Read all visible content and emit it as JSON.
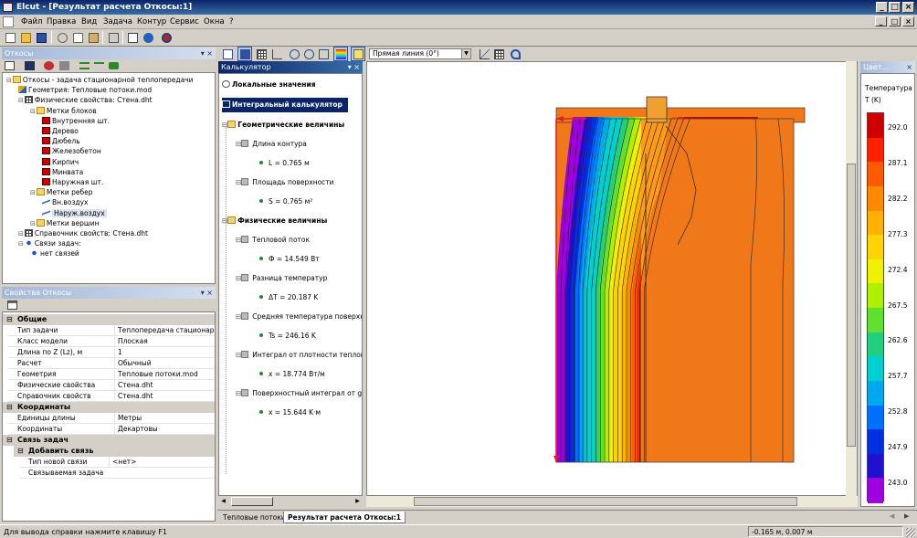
{
  "app": {
    "title": "Elcut - [Результат расчета Откосы:1]",
    "win_min": "_",
    "win_max": "□",
    "win_close": "×",
    "child_min": "_",
    "child_max": "□",
    "child_close": "×"
  },
  "menu": [
    "Файл",
    "Правка",
    "Вид",
    "Задача",
    "Контур",
    "Сервис",
    "Окна",
    "?"
  ],
  "problem_panel": {
    "title": "Откосы",
    "tree": [
      {
        "label": "Откосы - задача стационарной теплопередачи",
        "level": 0,
        "icon": "folder-icon"
      },
      {
        "label": "Геометрия: Тепловые потоки.mod",
        "level": 1,
        "icon": "geometry-icon"
      },
      {
        "label": "Физические свойства: Стена.dht",
        "level": 1,
        "icon": "table-icon"
      },
      {
        "label": "Метки блоков",
        "level": 2,
        "icon": "folder-icon"
      },
      {
        "label": "Внутренняя шт.",
        "level": 3,
        "icon": "block-label-icon"
      },
      {
        "label": "Дерево",
        "level": 3,
        "icon": "block-label-icon"
      },
      {
        "label": "Дюбель",
        "level": 3,
        "icon": "block-label-icon"
      },
      {
        "label": "Железобетон",
        "level": 3,
        "icon": "block-label-icon"
      },
      {
        "label": "Кирпич",
        "level": 3,
        "icon": "block-label-icon"
      },
      {
        "label": "Минвата",
        "level": 3,
        "icon": "block-label-icon"
      },
      {
        "label": "Наружная шт.",
        "level": 3,
        "icon": "block-label-icon"
      },
      {
        "label": "Метки ребер",
        "level": 2,
        "icon": "folder-icon"
      },
      {
        "label": "Вн.воздух",
        "level": 3,
        "icon": "edge-label-icon"
      },
      {
        "label": "Наруж.воздух",
        "level": 3,
        "icon": "edge-label-icon"
      },
      {
        "label": "Метки вершин",
        "level": 2,
        "icon": "folder-icon"
      },
      {
        "label": "Справочник свойств: Стена.dht",
        "level": 1,
        "icon": "table-icon"
      },
      {
        "label": "Связи задач:",
        "level": 1,
        "icon": "link-icon"
      },
      {
        "label": "нет связей",
        "level": 2,
        "icon": "link-icon"
      }
    ]
  },
  "properties_panel": {
    "title": "Свойства Откосы",
    "sections": [
      {
        "name": "Общие",
        "rows": [
          [
            "Тип задачи",
            "Теплопередача стационарная"
          ],
          [
            "Класс модели",
            "Плоская"
          ],
          [
            "Длина по Z (Lz), м",
            "1"
          ],
          [
            "Расчет",
            "Обычный"
          ],
          [
            "Геометрия",
            "Тепловые потоки.mod"
          ],
          [
            "Физические свойства",
            "Стена.dht"
          ],
          [
            "Справочник свойств",
            "Стена.dht"
          ]
        ]
      },
      {
        "name": "Координаты",
        "rows": [
          [
            "Единицы длины",
            "Метры"
          ],
          [
            "Координаты",
            "Декартовы"
          ]
        ]
      },
      {
        "name": "Связь задач",
        "rows": []
      },
      {
        "name": "Добавить связь",
        "rows": [
          [
            "Тип новой связи",
            "<нет>"
          ],
          [
            "Связываемая задача",
            ""
          ]
        ]
      }
    ]
  },
  "calculator": {
    "title": "Калькулятор",
    "local_values": "Локальные значения",
    "integral_calc": "Интегральный калькулятор",
    "groups": [
      {
        "name": "Геометрические величины",
        "items": [
          {
            "name": "Длина контура",
            "value": "L = 0.765 м"
          },
          {
            "name": "Площадь поверхности",
            "value": "S = 0.765 м²"
          }
        ]
      },
      {
        "name": "Физические величины",
        "items": [
          {
            "name": "Тепловой поток",
            "value": "Ф = 14.549 Вт"
          },
          {
            "name": "Разница температур",
            "value": "ΔT = 20.187 K"
          },
          {
            "name": "Средняя температура поверхно",
            "value": "Ts = 246.16 K"
          },
          {
            "name": "Интеграл от плотности теплово",
            "value": "x = 18.774 Вт/м"
          },
          {
            "name": "Поверхностный интеграл от gra",
            "value": "x = 15.644 K·м"
          }
        ]
      }
    ]
  },
  "view": {
    "contour_dropdown": "Прямая линия (0°)"
  },
  "legend": {
    "title": "Цвет...",
    "caption": "Температура",
    "unit": "T (K)",
    "ticks": [
      "292.0",
      "287.1",
      "282.2",
      "277.3",
      "272.4",
      "267.5",
      "262.6",
      "257.7",
      "252.8",
      "247.9",
      "243.0"
    ],
    "colors": [
      "#d00000",
      "#ff2000",
      "#ff5a00",
      "#ff8a00",
      "#ffb000",
      "#ffd400",
      "#f0f000",
      "#b0f000",
      "#60e030",
      "#20d080",
      "#00d0d0",
      "#00a8f0",
      "#0070ff",
      "#0030e0",
      "#2010d0",
      "#a000e0"
    ]
  },
  "doc_tabs": [
    "Тепловые потоки",
    "Результат расчета Откосы:1"
  ],
  "status": {
    "help": "Для вывода справки нажмите клавишу F1",
    "coords": "-0.165 м, 0.007 м"
  }
}
